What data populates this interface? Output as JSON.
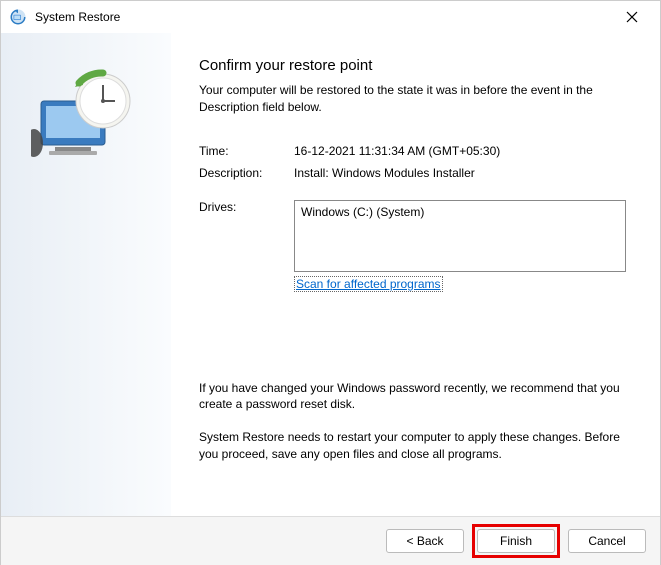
{
  "titlebar": {
    "title": "System Restore"
  },
  "heading": "Confirm your restore point",
  "subtext": "Your computer will be restored to the state it was in before the event in the Description field below.",
  "fields": {
    "time_label": "Time:",
    "time_value": "16-12-2021 11:31:34 AM (GMT+05:30)",
    "desc_label": "Description:",
    "desc_value": "Install: Windows Modules Installer",
    "drives_label": "Drives:",
    "drives_value": "Windows (C:) (System)"
  },
  "scan_link": "Scan for affected programs",
  "info": {
    "p1": "If you have changed your Windows password recently, we recommend that you create a password reset disk.",
    "p2": "System Restore needs to restart your computer to apply these changes. Before you proceed, save any open files and close all programs."
  },
  "buttons": {
    "back": "< Back",
    "finish": "Finish",
    "cancel": "Cancel"
  }
}
